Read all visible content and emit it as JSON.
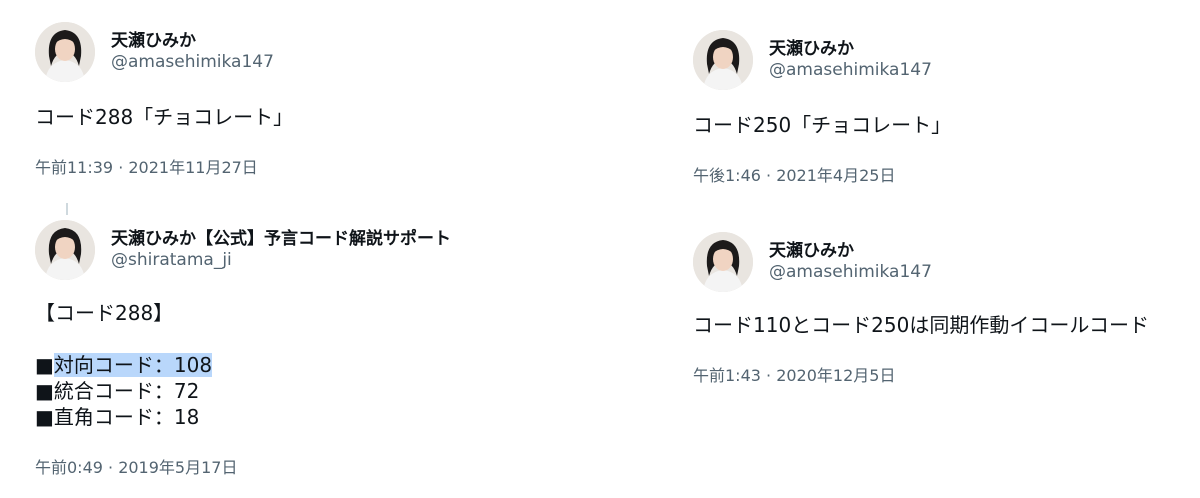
{
  "tweets": [
    {
      "name": "天瀬ひみか",
      "handle": "@amasehimika147",
      "text": "コード288「チョコレート」",
      "timestamp": "午前11:39 · 2021年11月27日"
    },
    {
      "name": "天瀬ひみか【公式】予言コード解説サポート",
      "handle": "@shiratama_ji",
      "lines": {
        "title": "【コード288】",
        "item1_bullet": "■",
        "item1_text": "対向コード：108",
        "item2": "■統合コード：72",
        "item3": "■直角コード：18"
      },
      "timestamp": "午前0:49 · 2019年5月17日"
    },
    {
      "name": "天瀬ひみか",
      "handle": "@amasehimika147",
      "text": "コード250「チョコレート」",
      "timestamp": "午後1:46 · 2021年4月25日"
    },
    {
      "name": "天瀬ひみか",
      "handle": "@amasehimika147",
      "text": "コード110とコード250は同期作動イコールコード",
      "timestamp": "午前1:43 · 2020年12月5日"
    }
  ],
  "colors": {
    "text": "#0f1419",
    "secondary": "#536471",
    "selection": "#b9d7fb",
    "thread_line": "#cfd9de"
  }
}
